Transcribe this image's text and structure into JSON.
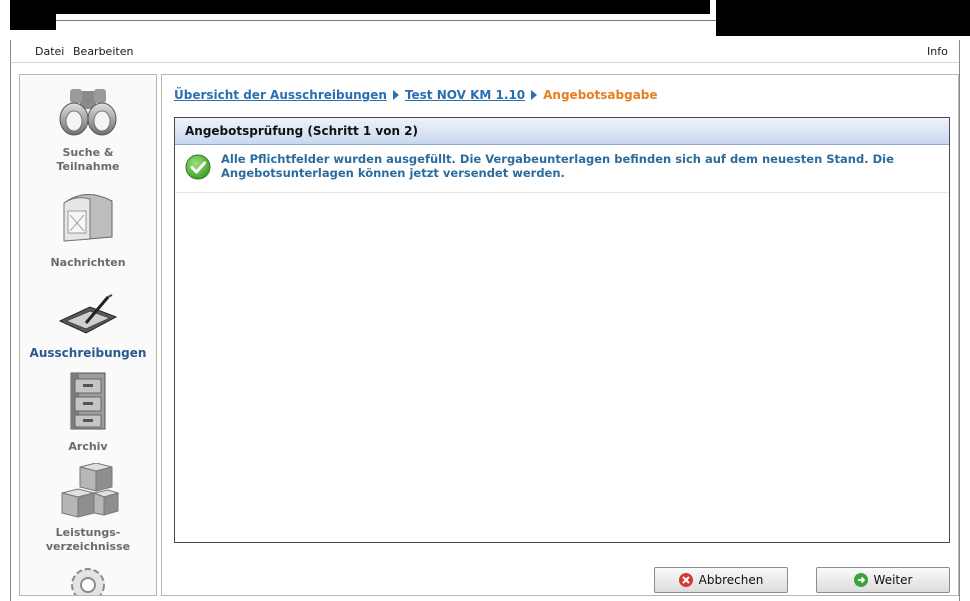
{
  "menu": {
    "datei": "Datei",
    "bearbeiten": "Bearbeiten",
    "info": "Info"
  },
  "nav": {
    "items": [
      {
        "label": "Suche &\nTeilnahme",
        "icon": "binoculars-icon",
        "active": false
      },
      {
        "label": "Nachrichten",
        "icon": "mailbox-icon",
        "active": false
      },
      {
        "label": "Ausschreibungen",
        "icon": "pen-tablet-icon",
        "active": true
      },
      {
        "label": "Archiv",
        "icon": "filing-cabinet-icon",
        "active": false
      },
      {
        "label": "Leistungs-\nverzeichnisse",
        "icon": "cubes-icon",
        "active": false
      },
      {
        "label": "",
        "icon": "gear-icon",
        "active": false
      }
    ]
  },
  "breadcrumb": {
    "item1": "Übersicht der Ausschreibungen",
    "item2": "Test NOV KM 1.10",
    "current": "Angebotsabgabe"
  },
  "panel": {
    "title": "Angebotsprüfung (Schritt 1 von 2)",
    "message": "Alle Pflichtfelder wurden ausgefüllt. Die Vergabeunterlagen befinden sich auf dem neuesten Stand. Die Angebotsunterlagen können jetzt versendet werden."
  },
  "buttons": {
    "cancel": "Abbrechen",
    "next": "Weiter"
  },
  "colors": {
    "link": "#2a6fb0",
    "current": "#e87e1e",
    "message": "#2b6c9c",
    "active_nav": "#2a5a8f"
  }
}
